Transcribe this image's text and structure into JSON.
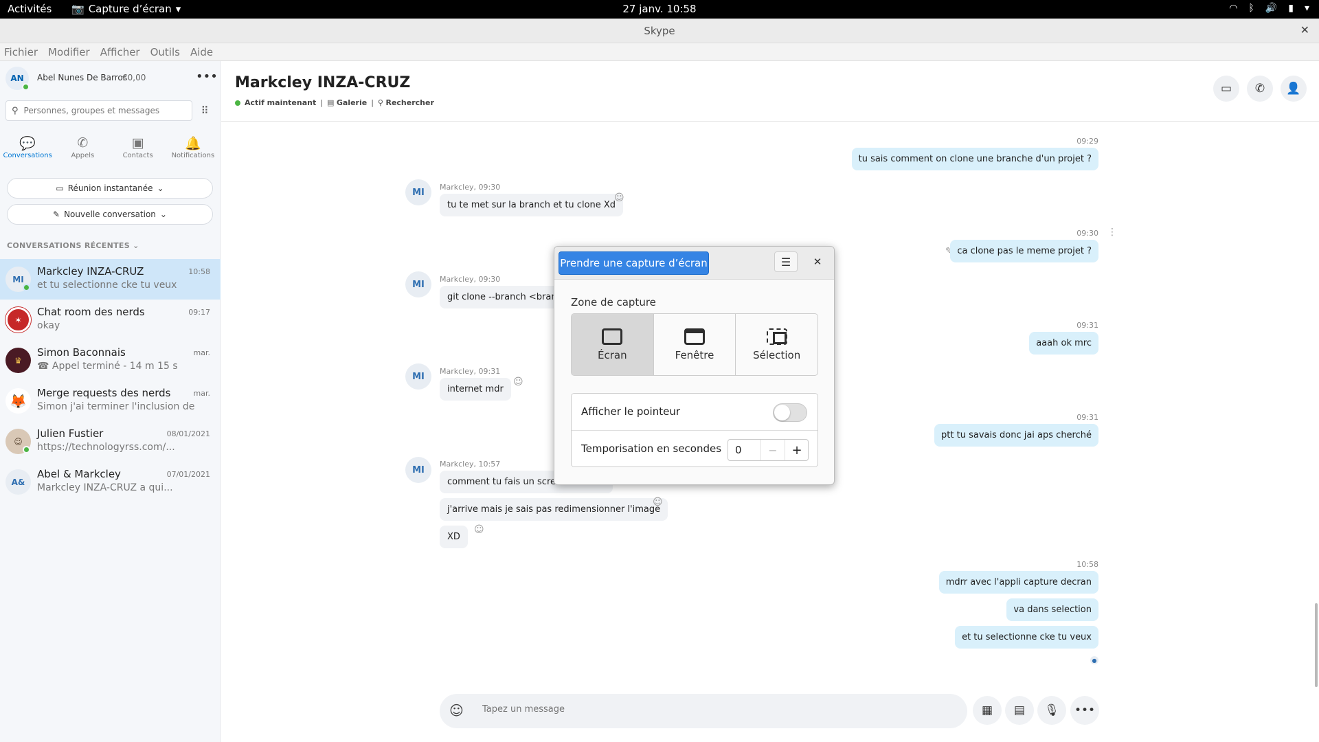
{
  "topbar": {
    "activities": "Activités",
    "app_name": "Capture d’écran",
    "clock": "27 janv.  10:58"
  },
  "window": {
    "title": "Skype"
  },
  "menu": [
    "Fichier",
    "Modifier",
    "Afficher",
    "Outils",
    "Aide"
  ],
  "profile": {
    "initials": "AN",
    "name": "Abel Nunes De Barros",
    "credit": "€0,00"
  },
  "search": {
    "placeholder": "Personnes, groupes et messages"
  },
  "nav": [
    "Conversations",
    "Appels",
    "Contacts",
    "Notifications"
  ],
  "buttons": {
    "meet_now": "Réunion instantanée",
    "new_conversation": "Nouvelle conversation"
  },
  "recent_header": "CONVERSATIONS RÉCENTES",
  "conversations": [
    {
      "initials": "MI",
      "name": "Markcley INZA-CRUZ",
      "preview": "et tu selectionne cke tu veux",
      "time": "10:58"
    },
    {
      "initials": "",
      "name": "Chat room des nerds",
      "preview": "okay",
      "time": "09:17"
    },
    {
      "initials": "",
      "name": "Simon Baconnais",
      "preview": "Appel terminé - 14 m 15 s",
      "time": "mar."
    },
    {
      "initials": "",
      "name": "Merge requests des nerds",
      "preview": "Simon j'ai terminer l'inclusion des...",
      "time": "mar."
    },
    {
      "initials": "",
      "name": "Julien Fustier",
      "preview": "https://technologyrss.com/...",
      "time": "08/01/2021"
    },
    {
      "initials": "A&",
      "name": "Abel & Markcley",
      "preview": "Markcley INZA-CRUZ a qui...",
      "time": "07/01/2021"
    }
  ],
  "chat_header": {
    "name": "Markcley INZA-CRUZ",
    "status": "Actif maintenant",
    "gallery": "Galerie",
    "find": "Rechercher"
  },
  "messages": {
    "t1": "09:29",
    "m1": "tu sais comment on clone une branche d'un projet ?",
    "s1": "Markcley, 09:30",
    "m2": "tu te met sur la branch et tu clone Xd",
    "t2": "09:30",
    "m3": "ca clone pas le meme projet ?",
    "s2": "Markcley, 09:30",
    "m4": "git clone --branch <branc",
    "t3": "09:31",
    "m5": "aaah ok mrc",
    "s3": "Markcley, 09:31",
    "m6": "internet mdr",
    "t4": "09:31",
    "m7": "ptt tu savais donc jai aps cherché",
    "s4": "Markcley, 10:57",
    "m8": "comment tu fais un screen shot XD",
    "m9": "j'arrive mais je sais pas redimensionner l'image",
    "m10": "XD",
    "t5": "10:58",
    "m11": "mdrr avec l'appli capture decran",
    "m12": "va dans selection",
    "m13": "et tu selectionne cke tu veux",
    "avatar_initials": "MI"
  },
  "composer": {
    "placeholder": "Tapez un message"
  },
  "dialog": {
    "take_button": "Prendre une capture d’écran",
    "zone_label": "Zone de capture",
    "zones": [
      "Écran",
      "Fenêtre",
      "Sélection"
    ],
    "active_zone": "Écran",
    "show_pointer_label": "Afficher le pointeur",
    "show_pointer": false,
    "delay_label": "Temporisation en secondes",
    "delay_value": "0"
  }
}
